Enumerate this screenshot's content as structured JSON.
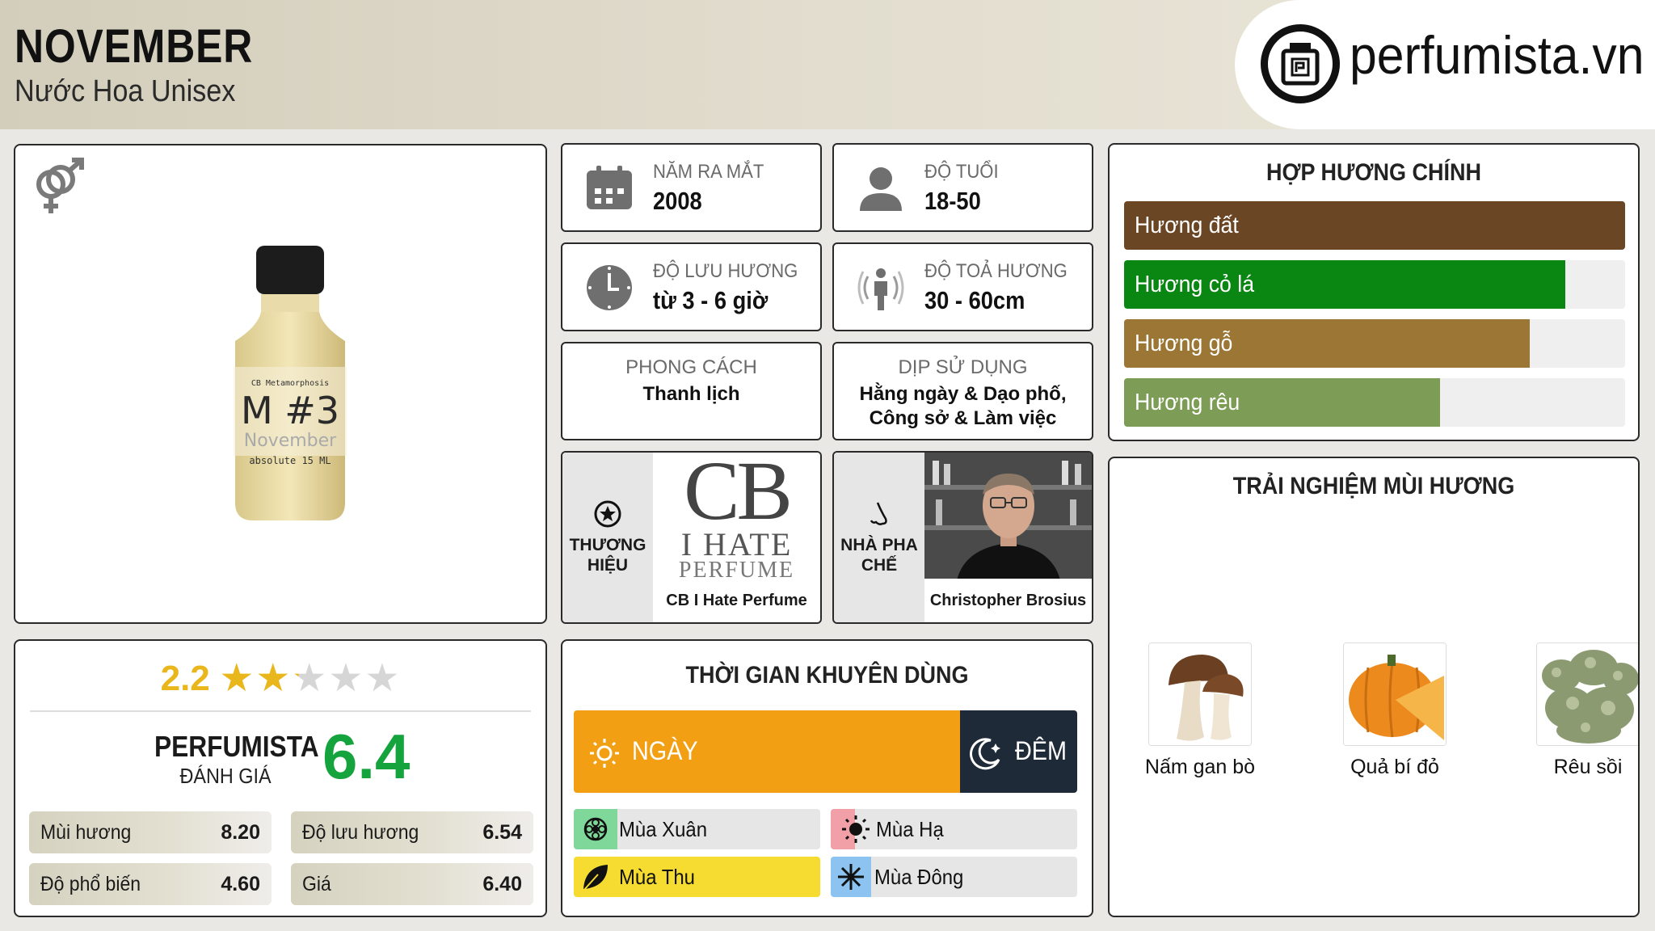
{
  "header": {
    "title": "NOVEMBER",
    "subtitle": "Nước Hoa Unisex",
    "logo_text": "perfumista.vn"
  },
  "product": {
    "gender_icon": "unisex-gender-icon",
    "bottle_label": {
      "brand_line": "CB Metamorphosis",
      "name_line": "M #3",
      "sub_line": "November",
      "size_line": "absolute 15 ML"
    }
  },
  "rating": {
    "user_score": "2.2",
    "user_stars": 2.2,
    "star_max": 5,
    "perfumista_label": "PERFUMISTA",
    "perfumista_sub": "ĐÁNH GIÁ",
    "perfumista_score": "6.4",
    "metrics": [
      {
        "label": "Mùi hương",
        "value": "8.20"
      },
      {
        "label": "Độ lưu hương",
        "value": "6.54"
      },
      {
        "label": "Độ phổ biến",
        "value": "4.60"
      },
      {
        "label": "Giá",
        "value": "6.40"
      }
    ]
  },
  "info": {
    "release": {
      "label": "NĂM RA MẮT",
      "value": "2008",
      "icon": "calendar-icon"
    },
    "age": {
      "label": "ĐỘ TUỔI",
      "value": "18-50",
      "icon": "person-icon"
    },
    "longevity": {
      "label": "ĐỘ LƯU HƯƠNG",
      "value": "từ 3 - 6 giờ",
      "icon": "clock-icon"
    },
    "sillage": {
      "label": "ĐỘ TOẢ HƯƠNG",
      "value": "30 - 60cm",
      "icon": "sillage-icon"
    },
    "style": {
      "label": "PHONG CÁCH",
      "value": "Thanh lịch"
    },
    "occasion": {
      "label": "DỊP SỬ DỤNG",
      "value": "Hằng ngày & Dạo phố, Công sở & Làm việc"
    },
    "brand": {
      "label": "THƯƠNG HIỆU",
      "logo_big": "CB",
      "logo_line1": "I HATE",
      "logo_line2": "PERFUME",
      "caption": "CB I Hate Perfume",
      "icon": "star-badge-icon"
    },
    "perfumer": {
      "label": "NHÀ PHA CHẾ",
      "caption": "Christopher Brosius",
      "icon": "nose-icon"
    }
  },
  "accords": {
    "title": "HỢP HƯƠNG CHÍNH",
    "items": [
      {
        "label": "Hương đất",
        "fraction": 1.0,
        "color": "#6b4624"
      },
      {
        "label": "Hương cỏ lá",
        "fraction": 0.88,
        "color": "#0a8612"
      },
      {
        "label": "Hương gỗ",
        "fraction": 0.81,
        "color": "#9b7634"
      },
      {
        "label": "Hương rêu",
        "fraction": 0.63,
        "color": "#7d9c55"
      }
    ]
  },
  "timing": {
    "title": "THỜI GIAN KHUYÊN DÙNG",
    "day_label": "NGÀY",
    "night_label": "ĐÊM",
    "day_icon": "sun-icon",
    "night_icon": "moon-icon",
    "seasons": [
      {
        "label": "Mùa Xuân",
        "icon": "flower-icon",
        "color": "#7fd89a"
      },
      {
        "label": "Mùa Hạ",
        "icon": "sun-icon",
        "color": "#f2a0a8"
      },
      {
        "label": "Mùa Thu",
        "icon": "leaf-icon",
        "color": "#f6dc30"
      },
      {
        "label": "Mùa Đông",
        "icon": "snowflake-icon",
        "color": "#8cc3f0"
      }
    ]
  },
  "experience": {
    "title": "TRẢI NGHIỆM MÙI HƯƠNG",
    "notes": [
      {
        "label": "Nấm gan bò",
        "icon": "mushroom-icon"
      },
      {
        "label": "Quả bí đỏ",
        "icon": "pumpkin-icon"
      },
      {
        "label": "Rêu sồi",
        "icon": "oakmoss-icon"
      }
    ]
  }
}
